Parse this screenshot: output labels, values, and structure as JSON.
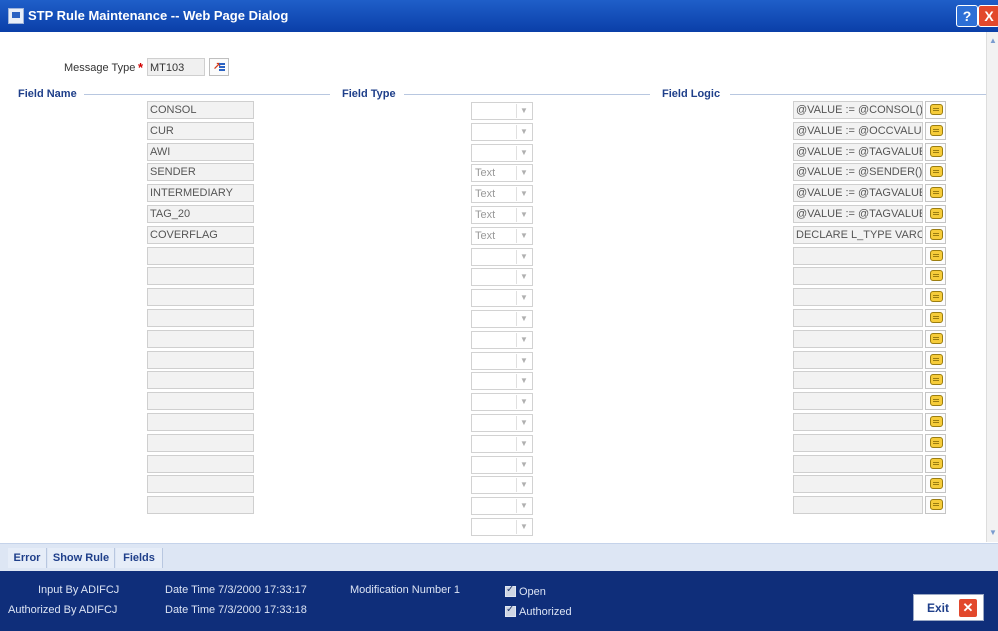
{
  "window": {
    "title": "STP Rule Maintenance -- Web Page Dialog",
    "help_label": "?",
    "close_label": "X"
  },
  "form": {
    "message_type_label": "Message Type",
    "required_mark": "*",
    "message_type_value": "MT103"
  },
  "sections": {
    "field_name": "Field Name",
    "field_type": "Field Type",
    "field_logic": "Field Logic"
  },
  "rows": [
    {
      "name": "CONSOL",
      "type": "",
      "logic": "@VALUE := @CONSOL();"
    },
    {
      "name": "CUR",
      "type": "",
      "logic": "@VALUE := @OCCVALUE("
    },
    {
      "name": "AWI",
      "type": "",
      "logic": "@VALUE := @TAGVALUE("
    },
    {
      "name": "SENDER",
      "type": "Text",
      "logic": "@VALUE := @SENDER();"
    },
    {
      "name": "INTERMEDIARY",
      "type": "Text",
      "logic": "@VALUE := @TAGVALUE("
    },
    {
      "name": "TAG_20",
      "type": "Text",
      "logic": "@VALUE := @TAGVALUE("
    },
    {
      "name": "COVERFLAG",
      "type": "Text",
      "logic": "DECLARE L_TYPE VARCH"
    },
    {
      "name": "",
      "type": "",
      "logic": ""
    },
    {
      "name": "",
      "type": "",
      "logic": ""
    },
    {
      "name": "",
      "type": "",
      "logic": ""
    },
    {
      "name": "",
      "type": "",
      "logic": ""
    },
    {
      "name": "",
      "type": "",
      "logic": ""
    },
    {
      "name": "",
      "type": "",
      "logic": ""
    },
    {
      "name": "",
      "type": "",
      "logic": ""
    },
    {
      "name": "",
      "type": "",
      "logic": ""
    },
    {
      "name": "",
      "type": "",
      "logic": ""
    },
    {
      "name": "",
      "type": "",
      "logic": ""
    },
    {
      "name": "",
      "type": "",
      "logic": ""
    },
    {
      "name": "",
      "type": "",
      "logic": ""
    },
    {
      "name": "",
      "type": "",
      "logic": ""
    }
  ],
  "extra_type_rows": 1,
  "tabs": [
    "Error",
    "Show Rule",
    "Fields"
  ],
  "footer": {
    "input_by": "Input By ADIFCJ",
    "authorized_by": "Authorized By ADIFCJ",
    "date_time_1": "Date Time 7/3/2000 17:33:17",
    "date_time_2": "Date Time 7/3/2000 17:33:18",
    "modification": "Modification Number 1",
    "open_label": "Open",
    "authorized_label": "Authorized",
    "exit_label": "Exit"
  },
  "colors": {
    "title_bar": "#0a3fa8",
    "footer": "#0f2e7a",
    "section_header": "#1f3f8a",
    "required": "#d10000",
    "close": "#e2482c"
  }
}
